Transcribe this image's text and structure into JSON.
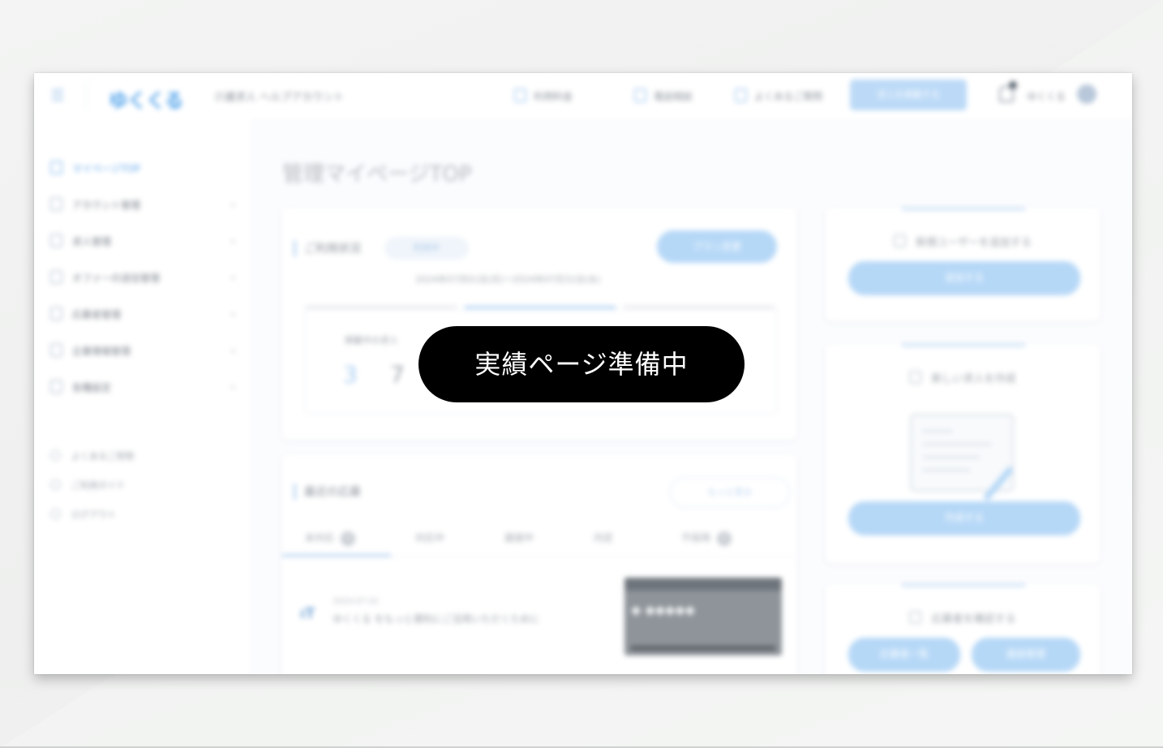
{
  "overlay": {
    "label": "実績ページ準備中"
  },
  "header": {
    "logo": "ゆくくる",
    "subtitle": "介護求人 ヘルプアカウント",
    "nav": [
      "利用料金",
      "電話相談",
      "よくあるご質問"
    ],
    "cta": "求人を掲載する",
    "user": "ゆくくる"
  },
  "sidebar": {
    "items": [
      {
        "label": "マイページTOP",
        "active": true
      },
      {
        "label": "アカウント管理"
      },
      {
        "label": "求人管理"
      },
      {
        "label": "オファーの送信管理"
      },
      {
        "label": "応募者管理"
      },
      {
        "label": "企業情報管理"
      },
      {
        "label": "各種設定"
      }
    ],
    "sub_items": [
      "よくあるご質問",
      "ご利用ガイド",
      "ログアウト"
    ]
  },
  "main": {
    "page_title": "管理マイページTOP",
    "plan_card": {
      "title": "ご利用状況",
      "status": "利用中",
      "button": "プラン変更",
      "date_range": "2024年07月01日(月)〜2024年07月31日(水)",
      "stat_label": "掲載中の求人",
      "stat_values": [
        "3",
        "7"
      ]
    },
    "applicants_card": {
      "title": "最近の応募",
      "button": "もっと見る",
      "tabs": [
        {
          "label": "未対応",
          "badge": "0"
        },
        {
          "label": "対応中"
        },
        {
          "label": "面接中"
        },
        {
          "label": "内定"
        },
        {
          "label": "不採用",
          "badge": "0"
        }
      ],
      "news": {
        "date": "2024.07.01",
        "text": "ゆくくる をもっと便利にご活用いただくために"
      }
    }
  },
  "right_cards": [
    {
      "title": "新規ユーザーを追加する",
      "button": "追加する"
    },
    {
      "title": "新しい求人を作成",
      "button": "作成する"
    },
    {
      "title": "応募者を確認する",
      "buttons": [
        "応募者一覧",
        "面接管理"
      ]
    }
  ],
  "colors": {
    "accent": "#4ea1ea",
    "overlay_bg": "#000000",
    "overlay_text": "#ffffff"
  }
}
